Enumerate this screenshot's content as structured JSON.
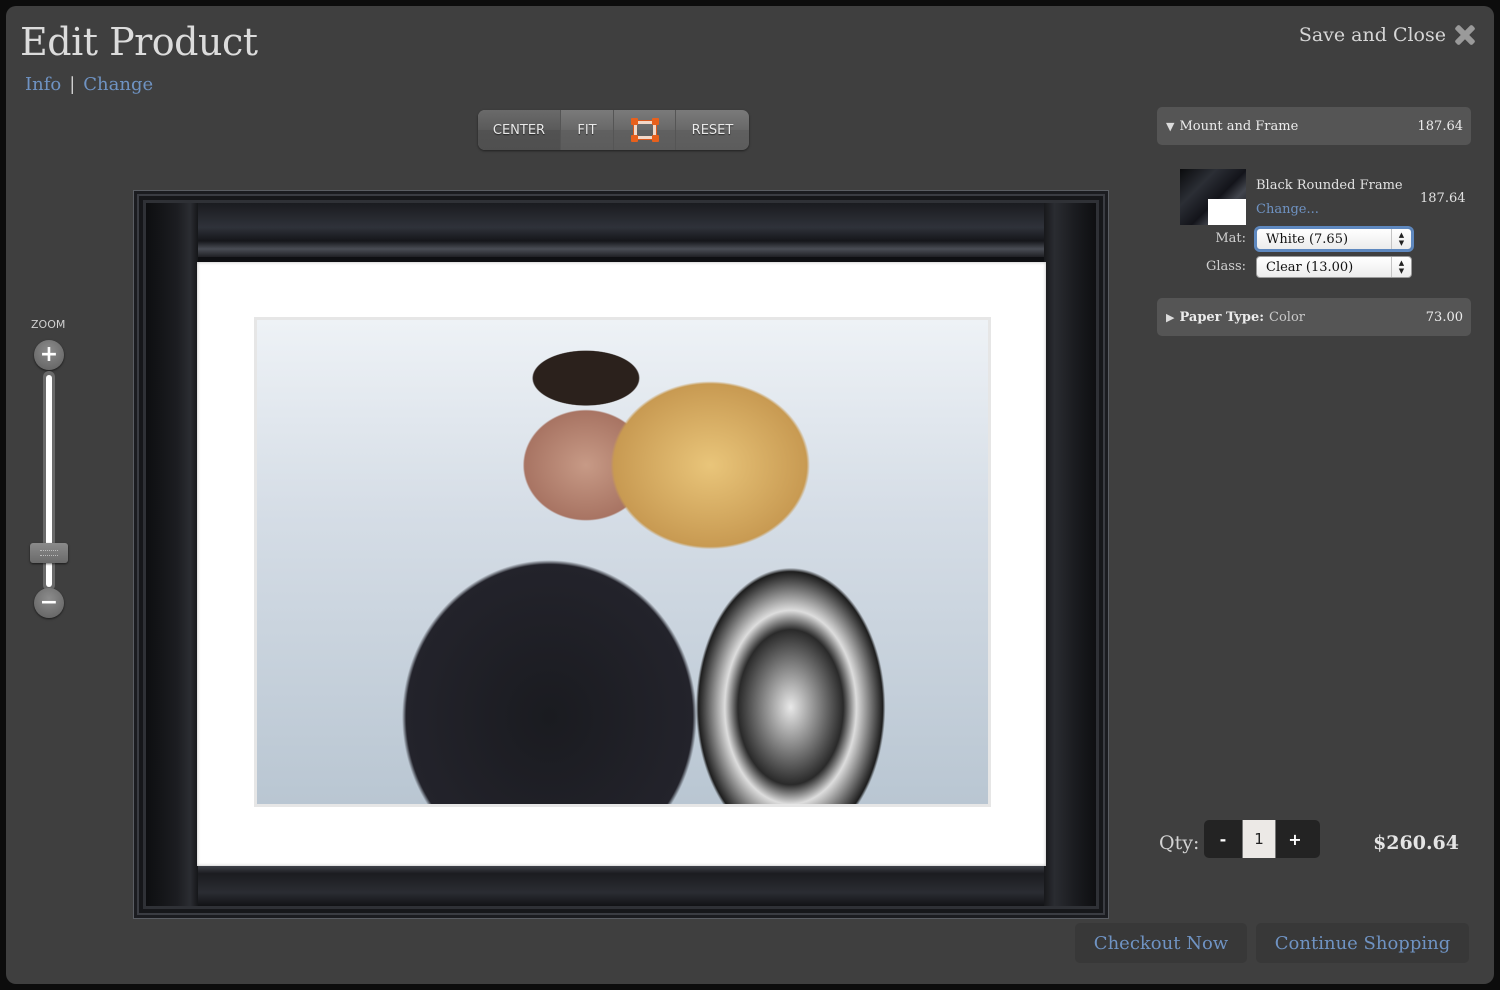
{
  "window": {
    "title": "Edit Product",
    "subnav": {
      "info": "Info",
      "separator": "|",
      "change": "Change"
    },
    "save_close": "Save and Close"
  },
  "toolbar": {
    "center": "CENTER",
    "fit": "FIT",
    "crop_icon": "crop-frame-icon",
    "reset": "RESET",
    "active": "center"
  },
  "zoom": {
    "label": "ZOOM",
    "plus": "+",
    "minus": "−",
    "level_fraction": 0.14
  },
  "preview": {
    "frame_color": "black",
    "mat_color": "white",
    "photo_subject": "couple embracing in snow"
  },
  "panel": {
    "mount_frame": {
      "label": "Mount and Frame",
      "price": "187.64",
      "expanded": true
    },
    "frame_item": {
      "name": "Black Rounded Frame",
      "change": "Change...",
      "price": "187.64"
    },
    "mat": {
      "label": "Mat:",
      "value": "White (7.65)"
    },
    "glass": {
      "label": "Glass:",
      "value": "Clear (13.00)"
    },
    "paper_type": {
      "label": "Paper Type:",
      "value": "Color",
      "price": "73.00",
      "expanded": false
    }
  },
  "order": {
    "qty_label": "Qty:",
    "qty_value": "1",
    "minus": "-",
    "plus": "+",
    "total": "$260.64",
    "checkout": "Checkout Now",
    "continue": "Continue Shopping"
  },
  "colors": {
    "link": "#6f93c3",
    "accent_crop": "#e8601c",
    "background": "#3f3f3f"
  }
}
